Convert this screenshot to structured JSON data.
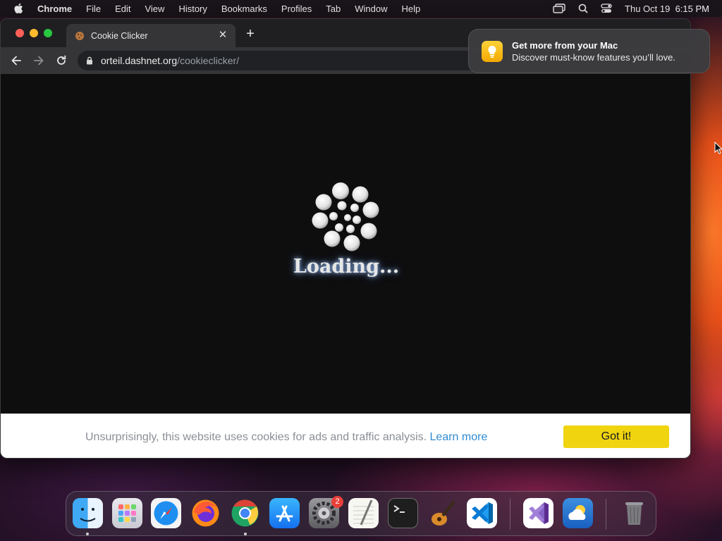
{
  "menubar": {
    "app": "Chrome",
    "items": [
      "File",
      "Edit",
      "View",
      "History",
      "Bookmarks",
      "Profiles",
      "Tab",
      "Window",
      "Help"
    ],
    "clock": "Thu Oct 19  6:15 PM"
  },
  "browser": {
    "tab_title": "Cookie Clicker",
    "url_host": "orteil.dashnet.org",
    "url_path": "/cookieclicker/"
  },
  "page": {
    "loading_text": "Loading...",
    "cookie_message": "Unsurprisingly, this website uses cookies for ads and traffic analysis.",
    "learn_more": "Learn more",
    "got_it": "Got it!"
  },
  "notification": {
    "title": "Get more from your Mac",
    "body": "Discover must-know features you’ll love."
  },
  "dock": {
    "apps": [
      "finder-icon",
      "launchpad-icon",
      "safari-icon",
      "firefox-icon",
      "chrome-icon",
      "app-store-icon",
      "system-settings-icon",
      "textedit-icon",
      "terminal-icon",
      "garageband-icon",
      "vscode-icon",
      "visual-studio-icon",
      "weather-icon",
      "trash-icon"
    ],
    "settings_badge": "2"
  },
  "colors": {
    "got_it_button": "#f0d410",
    "learn_more_link": "#2e8bd1"
  }
}
